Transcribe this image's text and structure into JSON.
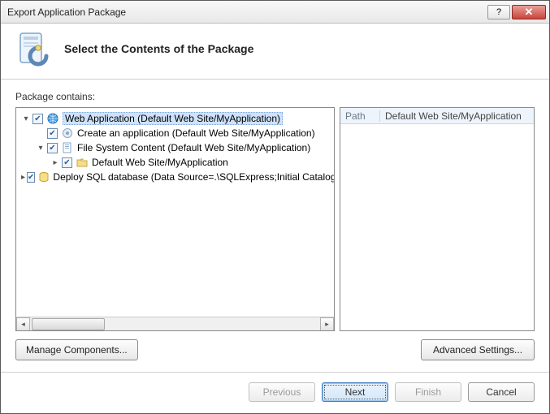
{
  "window": {
    "title": "Export Application Package"
  },
  "header": {
    "title": "Select the Contents of the Package"
  },
  "body": {
    "label": "Package contains:"
  },
  "tree": {
    "n0": "Web Application (Default Web Site/MyApplication)",
    "n1": "Create an application (Default Web Site/MyApplication)",
    "n2": "File System Content (Default Web Site/MyApplication)",
    "n3": "Default Web Site/MyApplication",
    "n4": "Deploy SQL database (Data Source=.\\SQLExpress;Initial Catalog="
  },
  "info": {
    "path_key": "Path",
    "path_val": "Default Web Site/MyApplication"
  },
  "buttons": {
    "manage": "Manage Components...",
    "advanced": "Advanced Settings...",
    "previous": "Previous",
    "next": "Next",
    "finish": "Finish",
    "cancel": "Cancel"
  }
}
